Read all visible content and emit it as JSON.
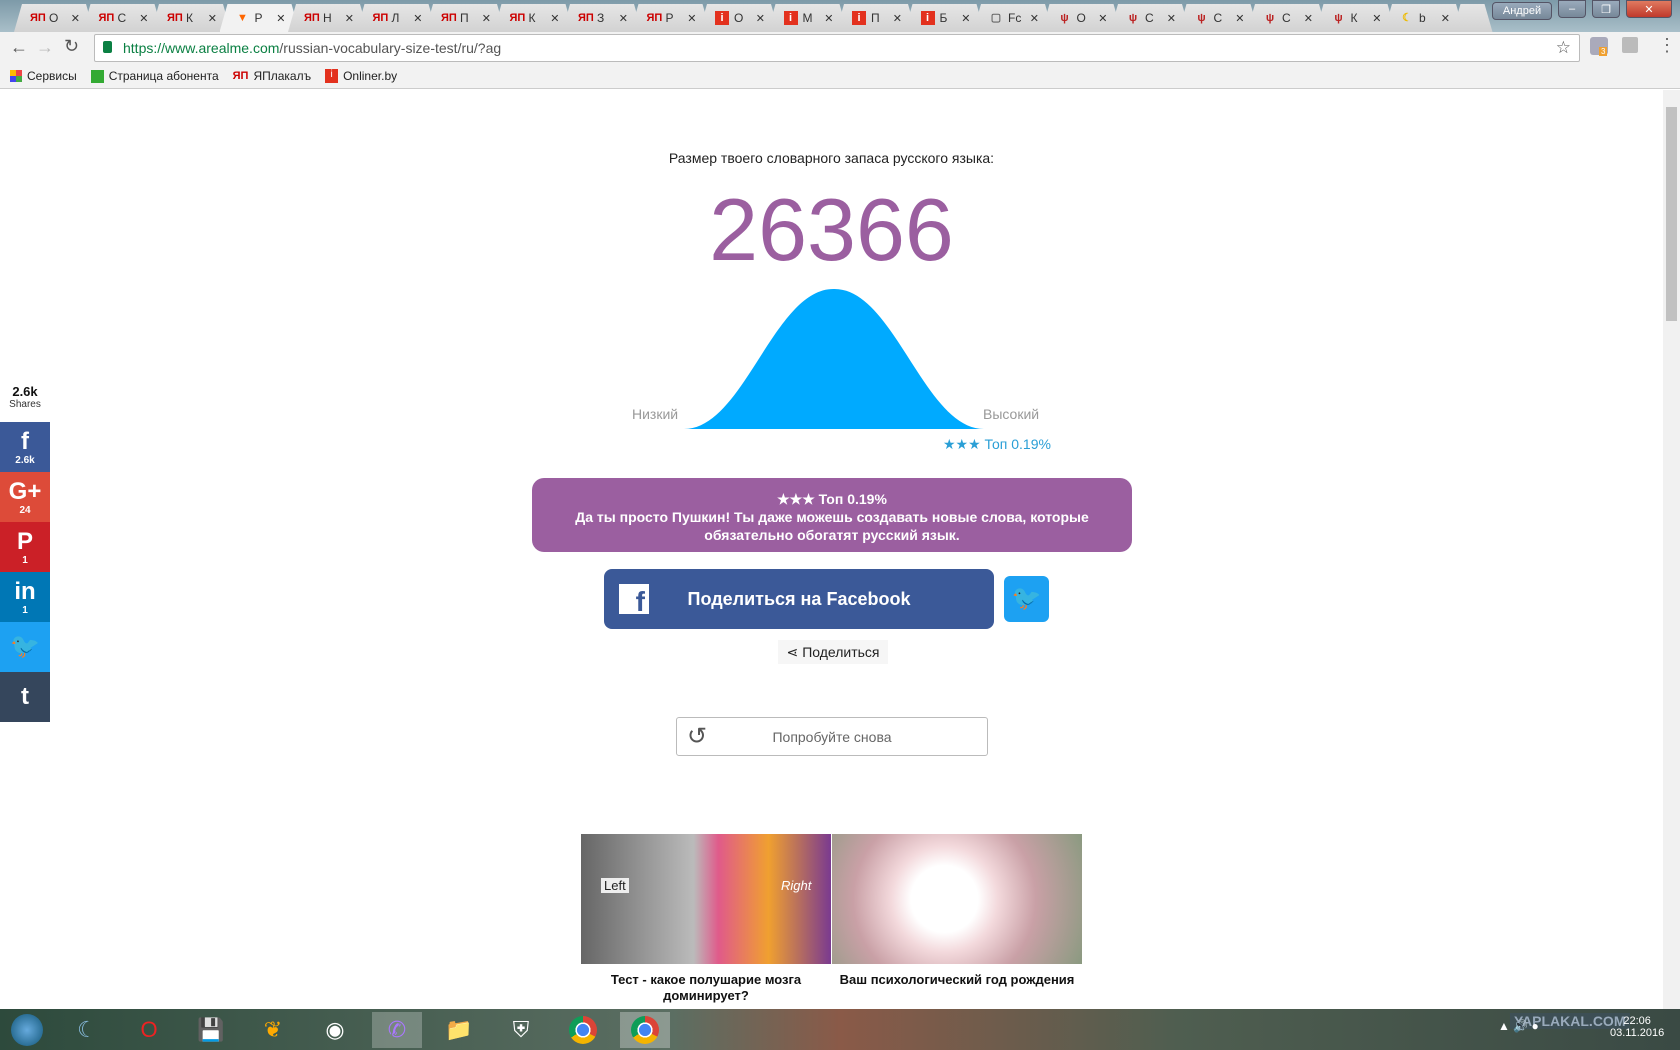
{
  "browser": {
    "tabs": [
      {
        "label": "О",
        "icon": "yaplakal-icon"
      },
      {
        "label": "С",
        "icon": "yaplakal-icon"
      },
      {
        "label": "К",
        "icon": "yaplakal-icon"
      },
      {
        "label": "Р",
        "icon": "fox-icon",
        "active": true
      },
      {
        "label": "Н",
        "icon": "yaplakal-icon"
      },
      {
        "label": "Л",
        "icon": "yaplakal-icon"
      },
      {
        "label": "П",
        "icon": "yaplakal-icon"
      },
      {
        "label": "К",
        "icon": "yaplakal-icon"
      },
      {
        "label": "З",
        "icon": "yaplakal-icon"
      },
      {
        "label": "Р",
        "icon": "yaplakal-icon"
      },
      {
        "label": "О",
        "icon": "onliner-icon"
      },
      {
        "label": "М",
        "icon": "onliner-icon"
      },
      {
        "label": "П",
        "icon": "onliner-icon"
      },
      {
        "label": "Б",
        "icon": "onliner-icon"
      },
      {
        "label": "Fc",
        "icon": "document-icon"
      },
      {
        "label": "О",
        "icon": "fork-knife-icon"
      },
      {
        "label": "С",
        "icon": "fork-knife-icon"
      },
      {
        "label": "С",
        "icon": "fork-knife-icon"
      },
      {
        "label": "С",
        "icon": "fork-knife-icon"
      },
      {
        "label": "К",
        "icon": "fork-knife-icon"
      },
      {
        "label": "b",
        "icon": "banana-icon"
      }
    ],
    "user": "Андрей",
    "url_host": "https://www.arealme.com",
    "url_path": "/russian-vocabulary-size-test/ru/?ag",
    "extension_badge": "3",
    "bookmarks": [
      "Сервисы",
      "Страница абонента",
      "ЯПлакалъ",
      "Onliner.by"
    ]
  },
  "result": {
    "heading": "Размер твоего словарного запаса русского языка:",
    "score": "26366",
    "low_label": "Низкий",
    "high_label": "Высокий",
    "rank": "★★★ Топ 0.19%",
    "message_title": "★★★ Топ 0.19%",
    "message_body": "Да ты просто Пушкин! Ты даже можешь создавать новые слова, которые обязательно обогатят русский язык.",
    "percentile_top": 0.19,
    "score_color": "#9b5fa0",
    "curve_color": "#00aaff"
  },
  "share": {
    "facebook_label": "Поделиться на Facebook",
    "share_label": "Поделиться",
    "retry_label": "Попробуйте снова",
    "total": "2.6k",
    "total_label": "Shares",
    "side": [
      {
        "icon": "facebook-icon",
        "glyph": "f",
        "count": "2.6k",
        "color": "#3b5998"
      },
      {
        "icon": "google-plus-icon",
        "glyph": "G+",
        "count": "24",
        "color": "#dd4b39"
      },
      {
        "icon": "pinterest-icon",
        "glyph": "P",
        "count": "1",
        "color": "#cb2027"
      },
      {
        "icon": "linkedin-icon",
        "glyph": "in",
        "count": "1",
        "color": "#0077b5"
      },
      {
        "icon": "twitter-icon",
        "glyph": "🐦",
        "count": "",
        "color": "#1da1f2"
      },
      {
        "icon": "tumblr-icon",
        "glyph": "t",
        "count": "",
        "color": "#35465c"
      }
    ]
  },
  "promos": [
    {
      "caption": "Тест - какое полушарие мозга доминирует?",
      "image_text_left": "Left",
      "image_text_right": "Right"
    },
    {
      "caption": "Ваш психологический год рождения"
    }
  ],
  "taskbar": {
    "watermark": "YAPLAKAL.COM",
    "time": "22:06",
    "date": "03.11.2016"
  }
}
